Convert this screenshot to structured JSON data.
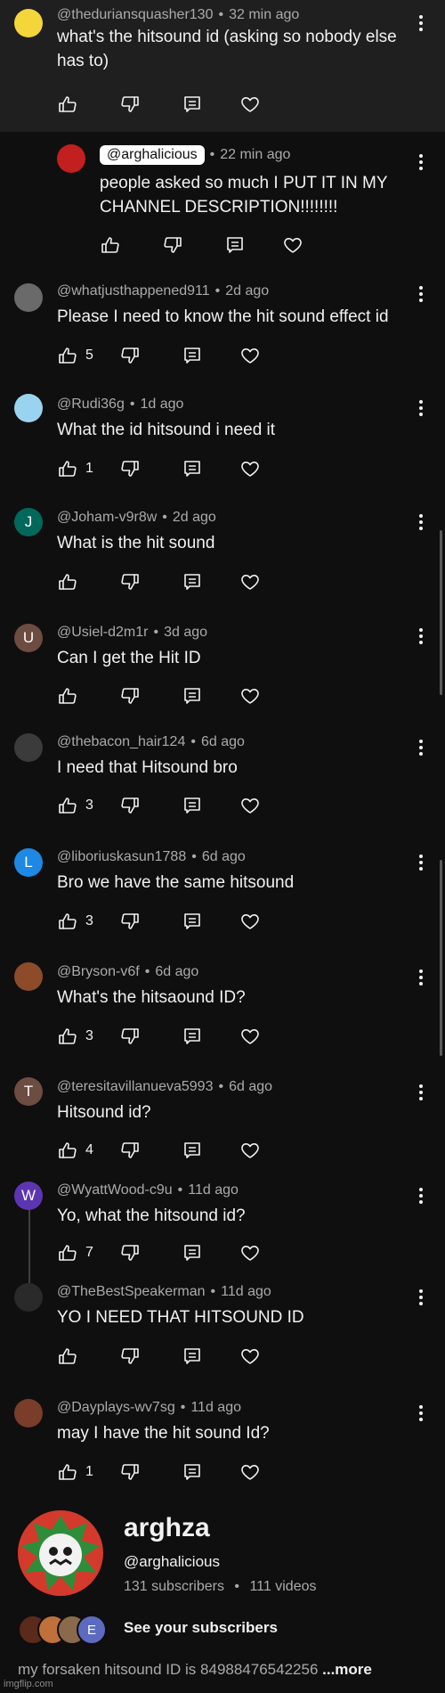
{
  "comments": [
    {
      "handle": "@theduriansquasher130",
      "time": "32 min ago",
      "text": "what's the hitsound id (asking so nobody else has to)",
      "likes": "",
      "avatar_color": "#f4d63a",
      "avatar_letter": "",
      "highlight": true,
      "reply": false
    },
    {
      "handle": "@arghalicious",
      "time": "22 min ago",
      "text": "people asked so much I PUT IT IN MY CHANNEL DESCRIPTION!!!!!!!!",
      "likes": "",
      "avatar_color": "#c21f1f",
      "avatar_letter": "",
      "highlight": false,
      "reply": true,
      "handle_chip": true
    },
    {
      "handle": "@whatjusthappened911",
      "time": "2d ago",
      "text": "Please I need to know the hit sound effect id",
      "likes": "5",
      "avatar_color": "#6a6a6a",
      "avatar_letter": ""
    },
    {
      "handle": "@Rudi36g",
      "time": "1d ago",
      "text": "What the id hitsound i need it",
      "likes": "1",
      "avatar_color": "#9ad3f0",
      "avatar_letter": ""
    },
    {
      "handle": "@Joham-v9r8w",
      "time": "2d ago",
      "text": "What is the hit sound",
      "likes": "",
      "avatar_color": "#00695c",
      "avatar_letter": "J"
    },
    {
      "handle": "@Usiel-d2m1r",
      "time": "3d ago",
      "text": "Can I get the Hit ID",
      "likes": "",
      "avatar_color": "#6d4c41",
      "avatar_letter": "U"
    },
    {
      "handle": "@thebacon_hair124",
      "time": "6d ago",
      "text": "I need that Hitsound bro",
      "likes": "3",
      "avatar_color": "#3b3b3b",
      "avatar_letter": ""
    },
    {
      "handle": "@liboriuskasun1788",
      "time": "6d ago",
      "text": "Bro we have the same hitsound",
      "likes": "3",
      "avatar_color": "#1e88e5",
      "avatar_letter": "L"
    },
    {
      "handle": "@Bryson-v6f",
      "time": "6d ago",
      "text": "What's the hitsaound ID?",
      "likes": "3",
      "avatar_color": "#8d4b2a",
      "avatar_letter": ""
    },
    {
      "handle": "@teresitavillanueva5993",
      "time": "6d ago",
      "text": "Hitsound id?",
      "likes": "4",
      "avatar_color": "#6d4c41",
      "avatar_letter": "T"
    },
    {
      "handle": "@WyattWood-c9u",
      "time": "11d ago",
      "text": "Yo, what the hitsound id?",
      "likes": "7",
      "avatar_color": "#5e35b1",
      "avatar_letter": "W"
    },
    {
      "handle": "@TheBestSpeakerman",
      "time": "11d ago",
      "text": "YO I NEED THAT HITSOUND ID",
      "likes": "",
      "avatar_color": "#2a2a2a",
      "avatar_letter": ""
    },
    {
      "handle": "@Dayplays-wv7sg",
      "time": "11d ago",
      "text": "may I have the hit sound Id?",
      "likes": "1",
      "avatar_color": "#7a3d2a",
      "avatar_letter": ""
    }
  ],
  "icons": {
    "like": "thumbs-up-icon",
    "dislike": "thumbs-down-icon",
    "reply": "reply-icon",
    "heart": "heart-icon",
    "menu": "kebab-menu-icon"
  },
  "channel": {
    "name": "arghza",
    "handle": "@arghalicious",
    "subscribers": "131 subscribers",
    "separator": "•",
    "videos": "111 videos",
    "see_subscribers": "See your subscribers",
    "subscriber_avatar_letter": "E",
    "description": "my forsaken hitsound ID is 84988476542256",
    "more": "...more"
  },
  "watermark": "imgflip.com"
}
